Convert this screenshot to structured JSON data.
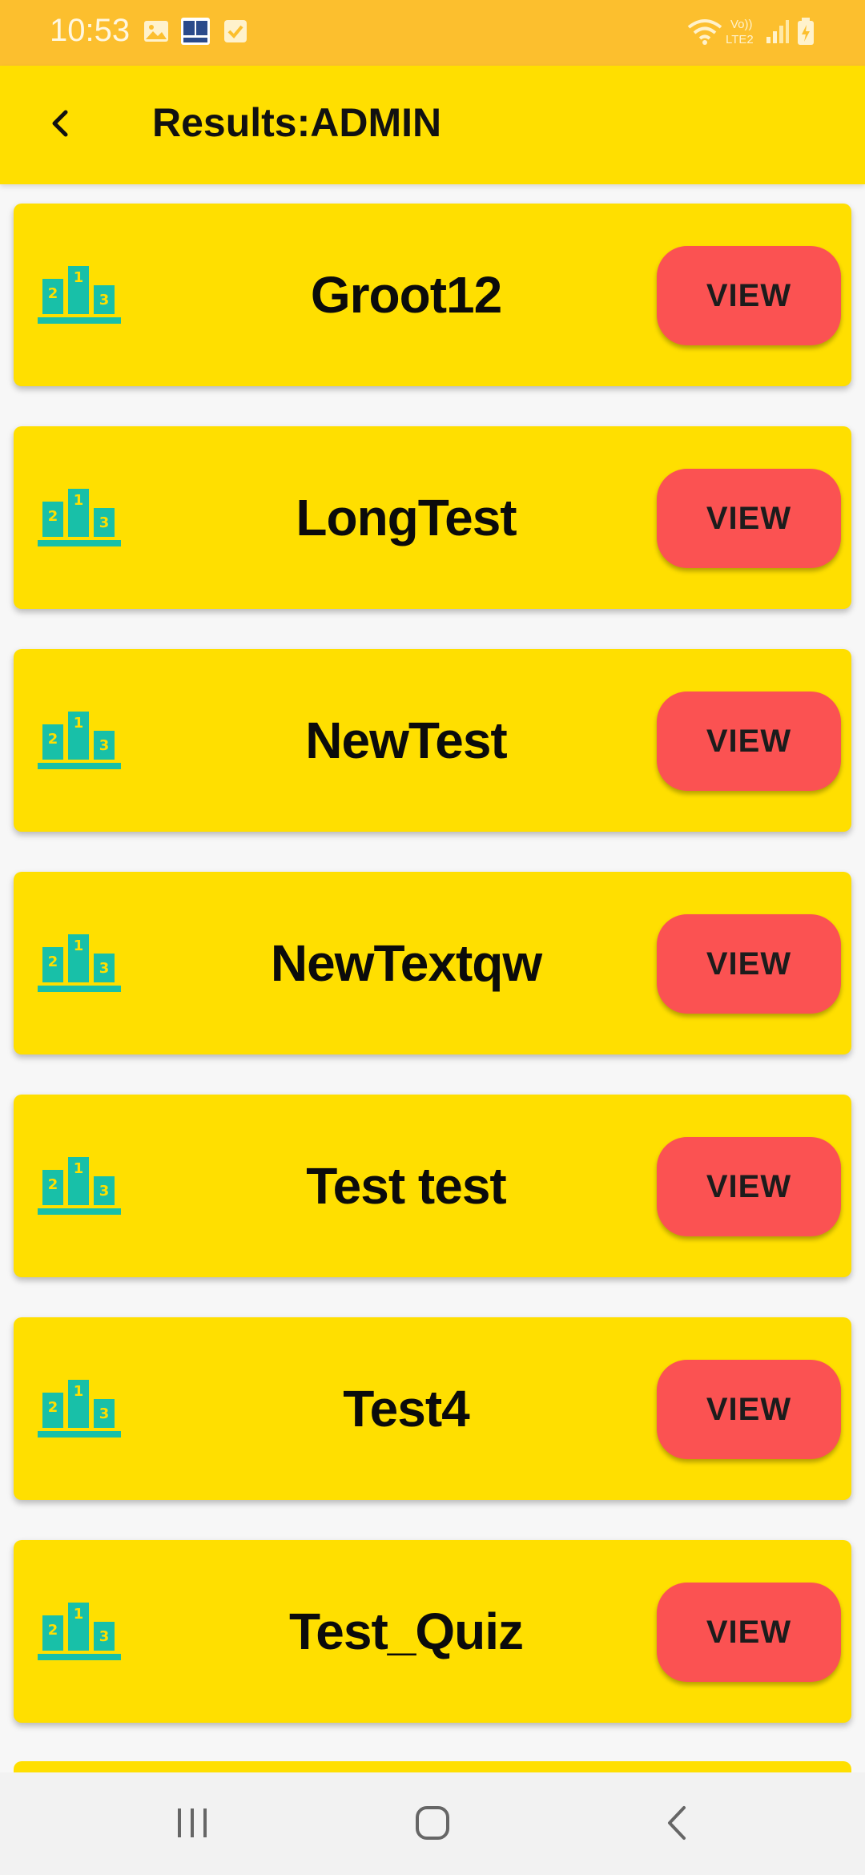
{
  "status_bar": {
    "time": "10:53",
    "icons": [
      "image-icon",
      "book-app-icon",
      "checkbox-icon",
      "wifi-icon",
      "volte-lte2-icon",
      "signal-icon",
      "battery-charging-icon"
    ]
  },
  "app_bar": {
    "title": "Results:ADMIN",
    "back_icon": "back-arrow-icon"
  },
  "quizzes": [
    {
      "name": "Groot12",
      "action": "VIEW"
    },
    {
      "name": "LongTest",
      "action": "VIEW"
    },
    {
      "name": "NewTest",
      "action": "VIEW"
    },
    {
      "name": "NewTextqw",
      "action": "VIEW"
    },
    {
      "name": "Test test",
      "action": "VIEW"
    },
    {
      "name": "Test4",
      "action": "VIEW"
    },
    {
      "name": "Test_Quiz",
      "action": "VIEW"
    }
  ],
  "podium_icon": {
    "name": "podium-icon",
    "labels": [
      "1",
      "2",
      "3"
    ],
    "color": "#18c0a8"
  },
  "colors": {
    "status_bar": "#fcbf2e",
    "app_bar": "#ffdf00",
    "card": "#ffdf00",
    "view_button": "#fb5252",
    "podium": "#18c0a8"
  },
  "nav_bar": {
    "items": [
      "recent-apps-icon",
      "home-icon",
      "back-icon"
    ]
  }
}
